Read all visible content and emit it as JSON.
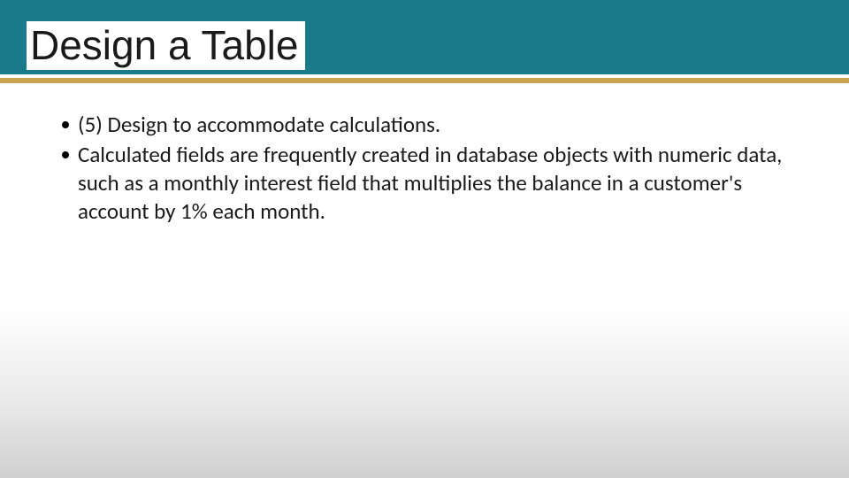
{
  "slide": {
    "title": "Design a Table",
    "bullets": [
      "(5) Design to accommodate calculations.",
      "Calculated fields are frequently created in database objects with numeric data, such as a monthly interest field that multiplies the balance in a customer's account by 1% each month."
    ]
  },
  "colors": {
    "header_bg": "#1a7a8a",
    "accent_line": "#c9a34e"
  }
}
